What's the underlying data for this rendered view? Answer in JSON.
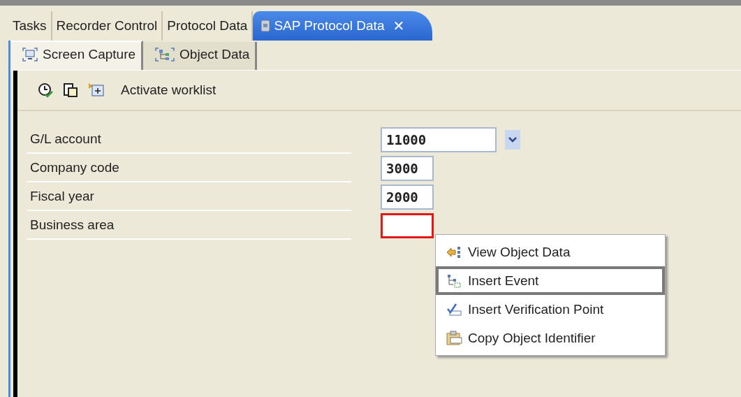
{
  "view_tabs": [
    {
      "label": "Tasks",
      "selected": false
    },
    {
      "label": "Recorder Control",
      "selected": false
    },
    {
      "label": "Protocol Data",
      "selected": false
    },
    {
      "label": "SAP Protocol Data",
      "selected": true,
      "close": "✕"
    }
  ],
  "sub_tabs": [
    {
      "label": "Screen Capture",
      "selected": true
    },
    {
      "label": "Object Data",
      "selected": false
    }
  ],
  "toolbar": {
    "label": "Activate worklist"
  },
  "fields": [
    {
      "label": "G/L account",
      "value": "11000",
      "kind": "dropdown",
      "highlighted": false
    },
    {
      "label": "Company code",
      "value": "3000",
      "kind": "text",
      "highlighted": false
    },
    {
      "label": "Fiscal year",
      "value": "2000",
      "kind": "text",
      "highlighted": false
    },
    {
      "label": "Business area",
      "kind": "text",
      "highlighted": true
    }
  ],
  "context_menu": [
    {
      "label": "View Object Data",
      "selected": false
    },
    {
      "label": "Insert Event",
      "selected": true
    },
    {
      "label": "Insert Verification Point",
      "selected": false
    },
    {
      "label": "Copy Object Identifier",
      "selected": false
    }
  ]
}
